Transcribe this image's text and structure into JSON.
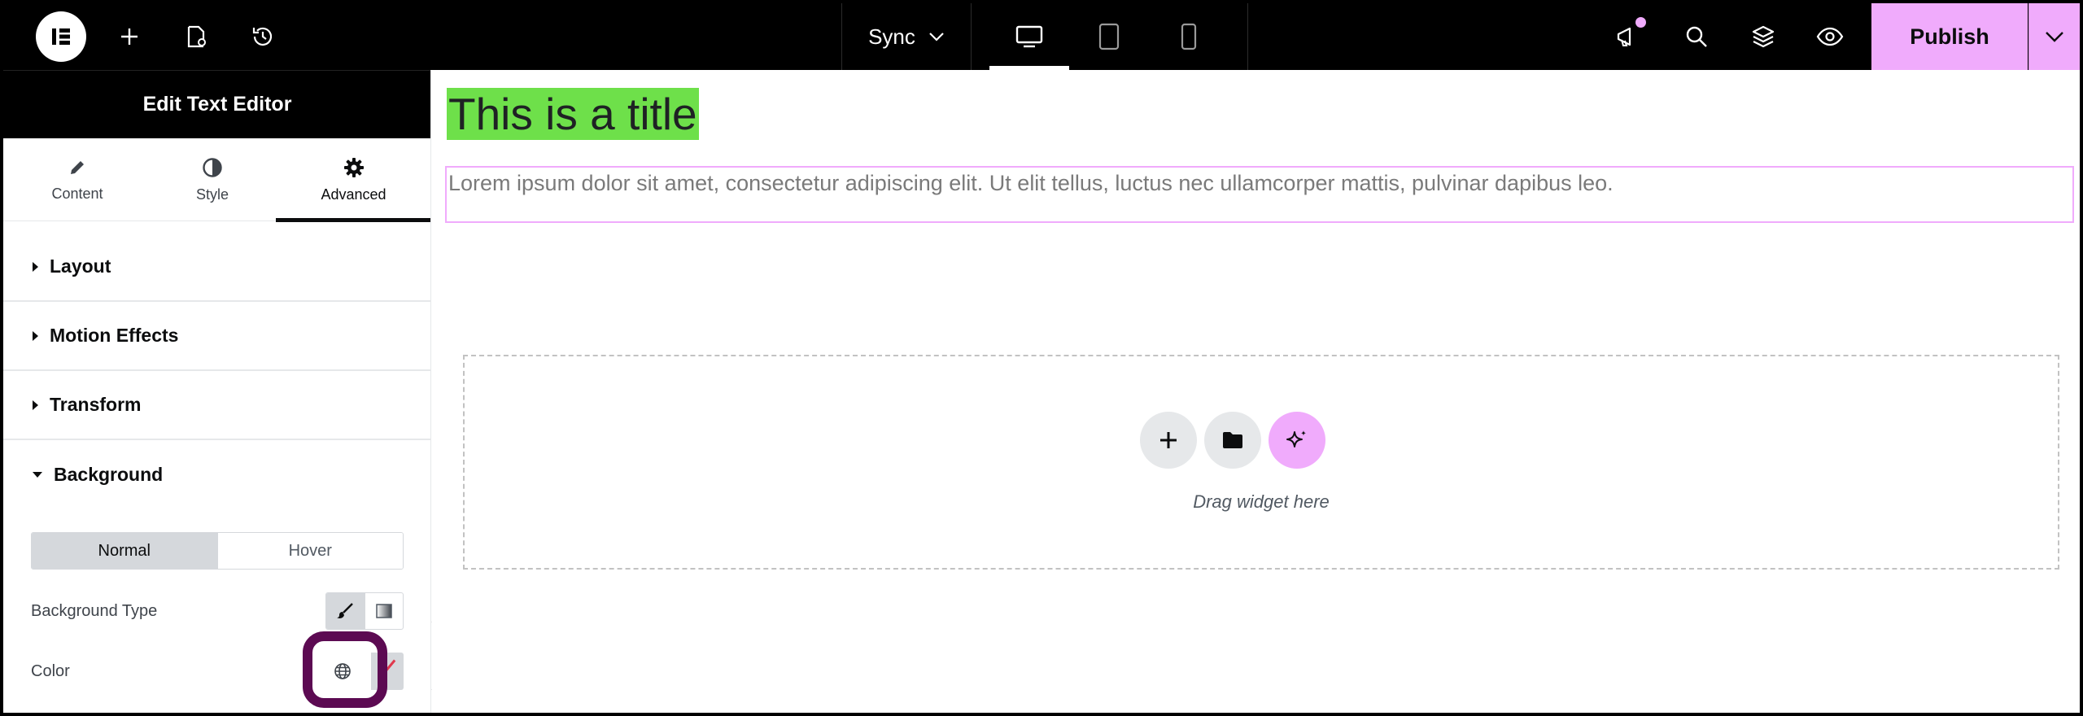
{
  "topbar": {
    "sync_label": "Sync",
    "publish_label": "Publish",
    "icons": [
      "elementor-logo-icon",
      "plus-icon",
      "page-settings-icon",
      "history-icon",
      "chevron-down-icon",
      "desktop-icon",
      "tablet-icon",
      "mobile-icon",
      "megaphone-icon",
      "search-icon",
      "layers-icon",
      "eye-icon"
    ],
    "accent_color": "#f0abfc"
  },
  "panel": {
    "header_title": "Edit Text Editor",
    "tabs": [
      {
        "label": "Content",
        "icon": "pencil-icon"
      },
      {
        "label": "Style",
        "icon": "contrast-icon"
      },
      {
        "label": "Advanced",
        "icon": "gear-icon"
      }
    ],
    "active_tab": "Advanced",
    "sections": [
      {
        "label": "Layout"
      },
      {
        "label": "Motion Effects"
      },
      {
        "label": "Transform"
      },
      {
        "label": "Background"
      }
    ],
    "background": {
      "state_options": [
        "Normal",
        "Hover"
      ],
      "selected_state": "Normal",
      "type_label": "Background Type",
      "color_label": "Color"
    }
  },
  "canvas": {
    "title": "This is a title",
    "title_highlight_color": "#6ee04a",
    "paragraph": "Lorem ipsum dolor sit amet, consectetur adipiscing elit. Ut elit tellus, luctus nec ullamcorper mattis, pulvinar dapibus leo.",
    "dropzone_text": "Drag widget here"
  },
  "annotation": {
    "ring_color": "#5c0a52"
  }
}
